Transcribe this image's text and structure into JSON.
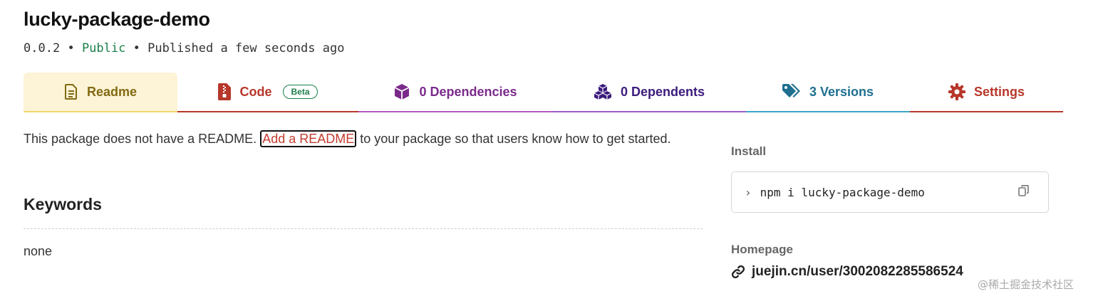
{
  "package": {
    "name": "lucky-package-demo",
    "version": "0.0.2",
    "separator1": "•",
    "visibility": "Public",
    "separator2": "•",
    "published": "Published a few seconds ago"
  },
  "tabs": [
    {
      "label": "Readme",
      "icon": "readme-icon",
      "color": "#826a12"
    },
    {
      "label": "Code",
      "icon": "code-file-icon",
      "badge": "Beta",
      "color": "#b7372a"
    },
    {
      "label": "0 Dependencies",
      "icon": "box-icon",
      "color": "#7b2a8c"
    },
    {
      "label": "0 Dependents",
      "icon": "boxes-icon",
      "color": "#3c1b7c"
    },
    {
      "label": "3 Versions",
      "icon": "tags-icon",
      "color": "#1e6f90"
    },
    {
      "label": "Settings",
      "icon": "gear-icon",
      "color": "#b7372a"
    }
  ],
  "readme": {
    "before_link": "This package does not have a README.",
    "link": "Add a README",
    "after_link": "to your package so that users know how to get started."
  },
  "keywords": {
    "title": "Keywords",
    "value": "none"
  },
  "sidebar": {
    "install_label": "Install",
    "install_prompt": "›",
    "install_command": "npm i lucky-package-demo",
    "copy_icon": "copy-icon",
    "homepage_label": "Homepage",
    "homepage_url": "juejin.cn/user/3002082285586524",
    "homepage_icon": "link-icon"
  },
  "watermark": "@稀土掘金技术社区",
  "colors": {
    "public": "#1b7f4a",
    "link": "#c23c2f"
  }
}
